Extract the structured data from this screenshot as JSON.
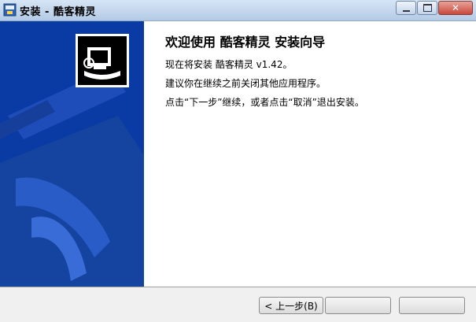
{
  "window": {
    "title": "安装 - 酷客精灵",
    "app_icon": "installer-icon",
    "controls": {
      "minimize_icon": "minimize-icon",
      "maximize_icon": "maximize-icon",
      "close_icon": "close-icon"
    }
  },
  "main": {
    "heading": "欢迎使用  酷客精灵  安装向导",
    "line1": "现在将安装  酷客精灵  v1.42。",
    "line2": "建议你在继续之前关闭其他应用程序。",
    "line3": "点击“下一步”继续，或者点击“取消”退出安装。"
  },
  "footer": {
    "back_label": "< 上一步(B)",
    "next_label": "",
    "cancel_label": ""
  },
  "colors": {
    "sidebar": "#0a3aa3",
    "title_bar": "#c9dcef"
  }
}
